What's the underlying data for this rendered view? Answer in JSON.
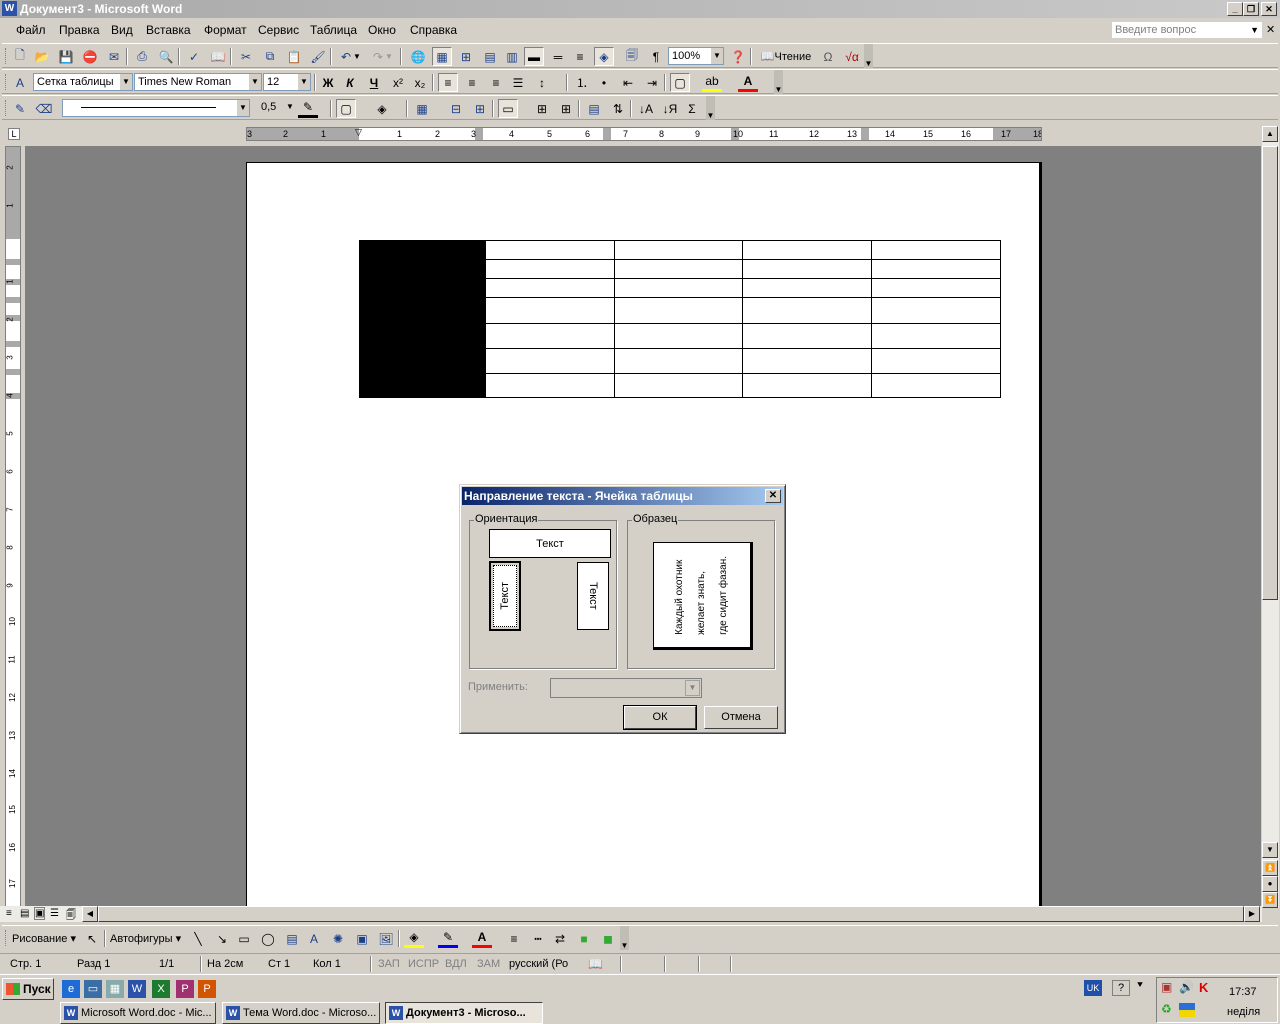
{
  "window": {
    "title": "Документ3 - Microsoft Word",
    "app_icon": "W"
  },
  "menu": [
    "Файл",
    "Правка",
    "Вид",
    "Вставка",
    "Формат",
    "Сервис",
    "Таблица",
    "Окно",
    "Справка"
  ],
  "help_box": {
    "placeholder": "Введите вопрос"
  },
  "standard_toolbar": {
    "zoom": "100%",
    "reading_label": "Чтение"
  },
  "formatting_toolbar": {
    "style": "Сетка таблицы",
    "font": "Times New Roman",
    "size": "12"
  },
  "tables_toolbar": {
    "line_weight": "0,5"
  },
  "hruler_numbers": [
    "3",
    "2",
    "1",
    "1",
    "2",
    "3",
    "4",
    "5",
    "6",
    "7",
    "8",
    "9",
    "10",
    "11",
    "12",
    "13",
    "14",
    "15",
    "16",
    "17",
    "18"
  ],
  "vruler_numbers": [
    "2",
    "1",
    "1",
    "2",
    "3",
    "4",
    "5",
    "6",
    "7",
    "8",
    "9",
    "10",
    "11",
    "12",
    "13",
    "14",
    "15",
    "16",
    "17"
  ],
  "drawing_toolbar": {
    "draw_label": "Рисование",
    "autoshapes_label": "Автофигуры"
  },
  "status": {
    "page": "Стр. 1",
    "section": "Разд 1",
    "pages": "1/1",
    "at": "На 2см",
    "line": "Ст 1",
    "col": "Кол 1",
    "rec": "ЗАП",
    "trk": "ИСПР",
    "ext": "ВДЛ",
    "ovr": "ЗАМ",
    "lang": "русский (Ро"
  },
  "taskbar": {
    "start": "Пуск",
    "tasks": [
      "Microsoft Word.doc - Mic...",
      "Тема Word.doc - Microso...",
      "Документ3 - Microso..."
    ],
    "lang_indicator": "UK",
    "time": "17:37",
    "day": "неділя"
  },
  "dialog": {
    "title": "Направление текста - Ячейка таблицы",
    "orientation_label": "Ориентация",
    "sample_label": "Образец",
    "orient_text": "Текст",
    "sample_lines": [
      "Каждый охотник",
      "желает знать,",
      "где сидит фазан."
    ],
    "apply_label": "Применить:",
    "ok": "ОК",
    "cancel": "Отмена"
  },
  "colors": {
    "dialog_title_start": "#0a246a",
    "dialog_title_end": "#a6caf0",
    "workspace": "#808080"
  }
}
